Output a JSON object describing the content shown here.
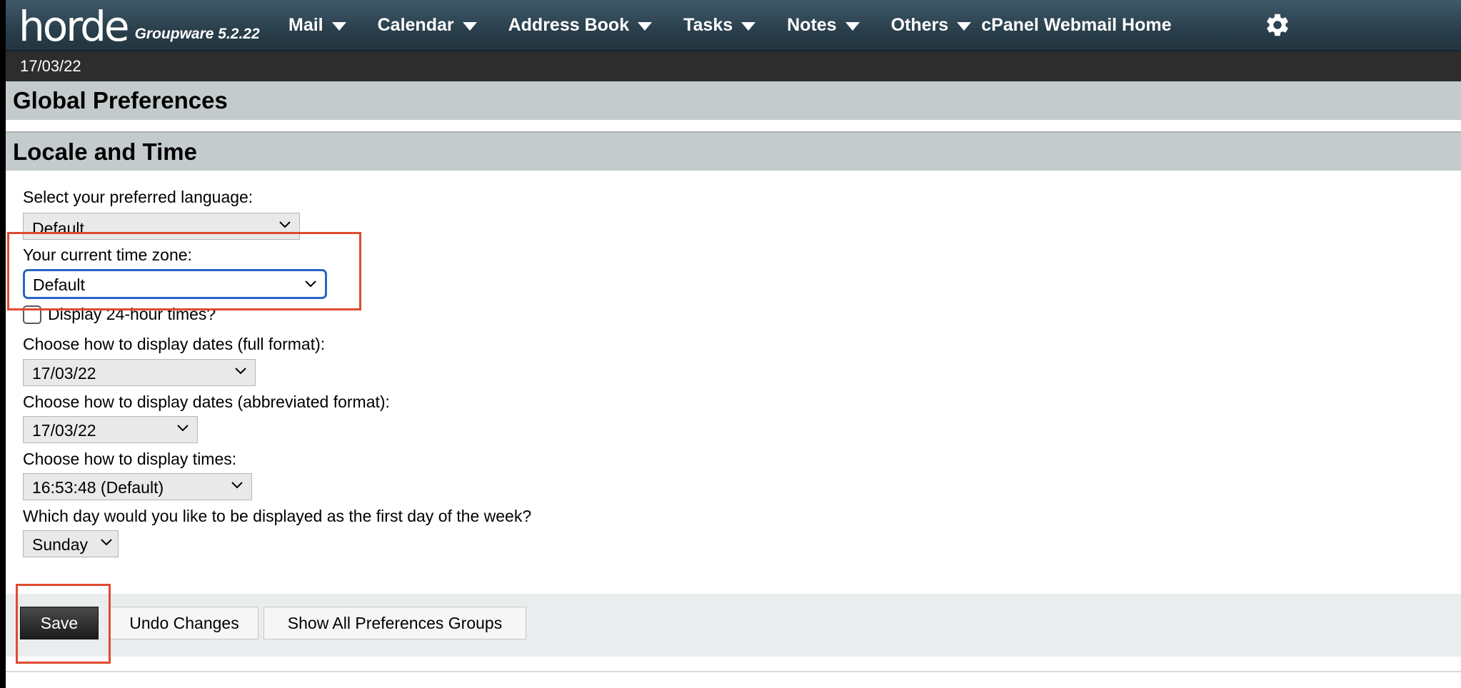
{
  "app": {
    "logo_text": "horde",
    "version_text": "Groupware 5.2.22"
  },
  "nav": {
    "items": [
      {
        "label": "Mail"
      },
      {
        "label": "Calendar"
      },
      {
        "label": "Address Book"
      },
      {
        "label": "Tasks"
      },
      {
        "label": "Notes"
      },
      {
        "label": "Others"
      }
    ],
    "home_label": "cPanel Webmail Home",
    "settings_icon": "gear-icon"
  },
  "date_bar": {
    "date": "17/03/22"
  },
  "headers": {
    "global": "Global Preferences",
    "section": "Locale and Time"
  },
  "form": {
    "language": {
      "label": "Select your preferred language:",
      "value": "Default"
    },
    "timezone": {
      "label": "Your current time zone:",
      "value": "Default"
    },
    "time24": {
      "label": "Display 24-hour times?",
      "checked": false
    },
    "date_full": {
      "label": "Choose how to display dates (full format):",
      "value": "17/03/22"
    },
    "date_short": {
      "label": "Choose how to display dates (abbreviated format):",
      "value": "17/03/22"
    },
    "time_format": {
      "label": "Choose how to display times:",
      "value": "16:53:48 (Default)"
    },
    "first_day": {
      "label": "Which day would you like to be displayed as the first day of the week?",
      "value": "Sunday"
    }
  },
  "buttons": {
    "save": "Save",
    "undo": "Undo Changes",
    "show_all": "Show All Preferences Groups"
  },
  "colors": {
    "annotation": "#e04a2f",
    "focus_ring": "#2a64c8",
    "header_bg": "#c4cbcc"
  }
}
